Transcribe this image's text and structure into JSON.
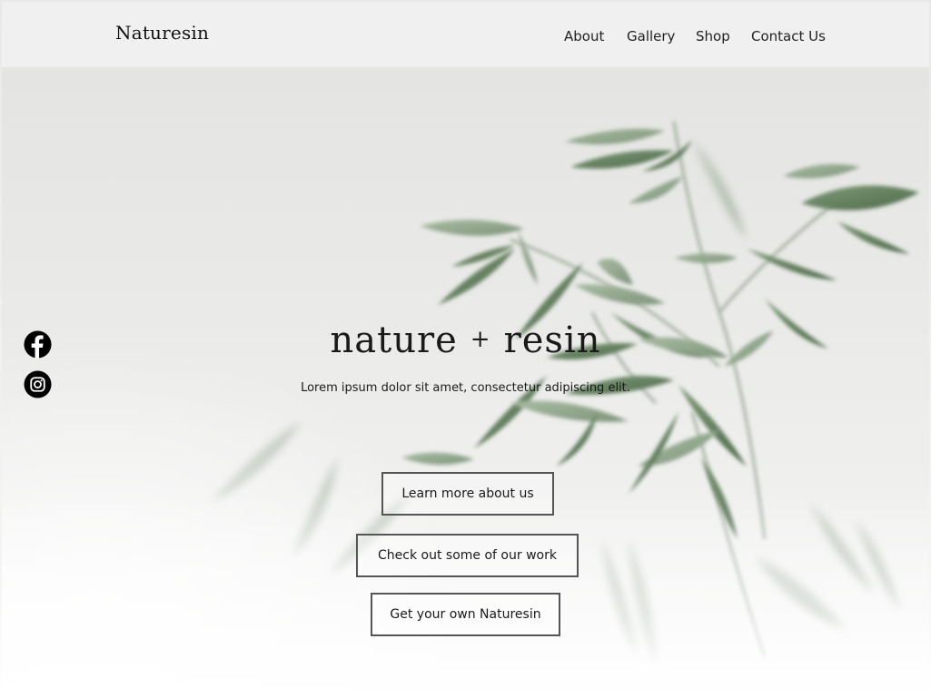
{
  "header": {
    "brand": "Naturesin",
    "nav": [
      {
        "label": "About"
      },
      {
        "label": "Gallery"
      },
      {
        "label": "Shop"
      },
      {
        "label": "Contact Us"
      }
    ]
  },
  "social": {
    "icons": [
      "facebook-icon",
      "instagram-icon"
    ]
  },
  "hero": {
    "title_left": "nature",
    "title_plus": "+",
    "title_right": "resin",
    "subtitle": "Lorem ipsum dolor sit amet, consectetur adipiscing elit.",
    "buttons": [
      {
        "label": "Learn more about us"
      },
      {
        "label": "Check out some of our work"
      },
      {
        "label": "Get your own Naturesin"
      }
    ]
  },
  "colors": {
    "leaf": "#6f8a6b",
    "leaf_dark": "#4f6d4c",
    "background": "#ebebea",
    "text": "#111111"
  }
}
